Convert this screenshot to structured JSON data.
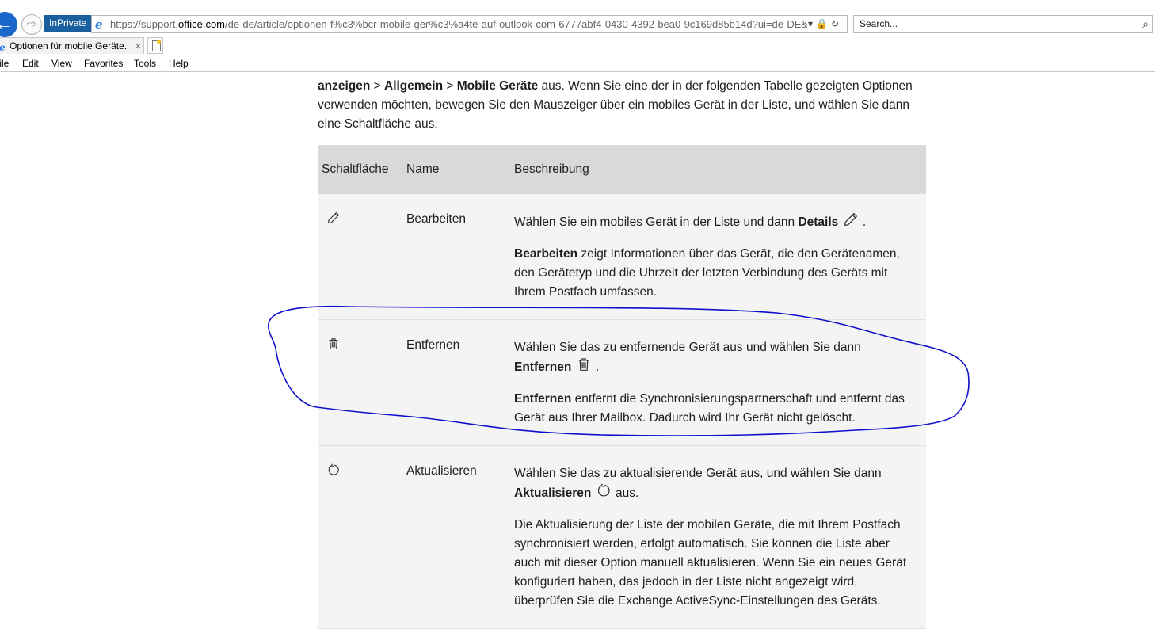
{
  "browser": {
    "inprivate_label": "InPrivate",
    "url_scheme": "https://support.",
    "url_domain": "office.com",
    "url_path": "/de-de/article/optionen-f%c3%bcr-mobile-ger%c3%a4te-auf-outlook-com-6777abf4-0430-4392-bea0-9c169d85b14d?ui=de-DE&rs=de-DE",
    "search_placeholder": "Search...",
    "tab_title": "Optionen für mobile Geräte...",
    "tab_close": "×",
    "menu": [
      "File",
      "Edit",
      "View",
      "Favorites",
      "Tools",
      "Help"
    ]
  },
  "intro": {
    "part1_bold": "anzeigen",
    "sep1": " > ",
    "part2_bold": "Allgemein",
    "sep2": " > ",
    "part3_bold": "Mobile Geräte",
    "rest": " aus. Wenn Sie eine der in der folgenden Tabelle gezeigten Optionen verwenden möchten, bewegen Sie den Mauszeiger über ein mobiles Gerät in der Liste, und wählen Sie dann eine Schaltfläche aus."
  },
  "table": {
    "headers": [
      "Schaltfläche",
      "Name",
      "Beschreibung"
    ],
    "rows": [
      {
        "icon": "pencil-icon",
        "name": "Bearbeiten",
        "p1_text": "Wählen Sie ein mobiles Gerät in der Liste und dann ",
        "p1_bold": "Details",
        "p1_end": " .",
        "p2_bold": "Bearbeiten",
        "p2_text": " zeigt Informationen über das Gerät, die den Gerätenamen, den Gerätetyp und die Uhrzeit der letzten Verbindung des Geräts mit Ihrem Postfach umfassen."
      },
      {
        "icon": "trash-icon",
        "name": "Entfernen",
        "p1_text": "Wählen Sie das zu entfernende Gerät aus und wählen Sie dann ",
        "p1_bold": "Entfernen",
        "p1_end": " .",
        "p2_bold": "Entfernen",
        "p2_text": " entfernt die Synchronisierungspartnerschaft und entfernt das Gerät aus Ihrer Mailbox. Dadurch wird Ihr Gerät nicht gelöscht."
      },
      {
        "icon": "refresh-icon",
        "name": "Aktualisieren",
        "p1_text": "Wählen Sie das zu aktualisierende Gerät aus, und wählen Sie dann ",
        "p1_bold": "Aktualisieren",
        "p1_end": " aus.",
        "p2_bold": "",
        "p2_text": "Die Aktualisierung der Liste der mobilen Geräte, die mit Ihrem Postfach synchronisiert werden, erfolgt automatisch. Sie können die Liste aber auch mit dieser Option manuell aktualisieren. Wenn Sie ein neues Gerät konfiguriert haben, das jedoch in der Liste nicht angezeigt wird, überprüfen Sie die Exchange ActiveSync-Einstellungen des Geräts."
      }
    ]
  },
  "colors": {
    "annotation": "#1010cc",
    "header_bg": "#d9d9d9",
    "row_bg": "#f4f4f4"
  }
}
